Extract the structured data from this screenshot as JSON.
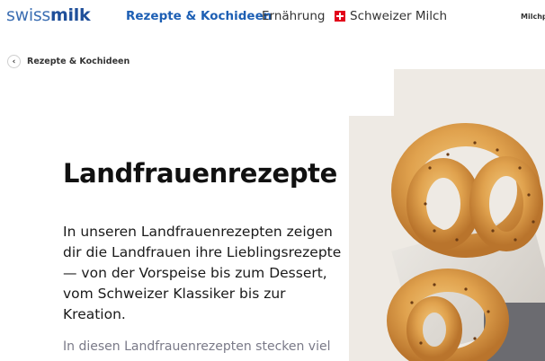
{
  "header": {
    "logo": {
      "part1": "swiss",
      "part2": "milk"
    },
    "nav": [
      {
        "label": "Rezepte & Kochideen",
        "active": true
      },
      {
        "label": "Ernährung"
      },
      {
        "label": "Schweizer Milch",
        "icon": "swiss-flag-icon"
      },
      {
        "label": "Milchp"
      }
    ]
  },
  "breadcrumb": {
    "label": "Rezepte & Kochideen",
    "icon": "chevron-left-icon"
  },
  "hero": {
    "title": "Landfrauenrezepte",
    "lead": "In unseren Landfrauenrezepten zeigen dir die Landfrauen ihre Lieblingsrezepte — von der Vorspeise bis zum Dessert, vom Schweizer Klassiker bis zur Kreation.",
    "more": "In diesen Landfrauenrezepten stecken viel"
  },
  "colors": {
    "brand_light": "#3d6fb3",
    "brand_dark": "#1f4f9a",
    "nav_active": "#1d5fb4",
    "flag_red": "#e2001a"
  }
}
